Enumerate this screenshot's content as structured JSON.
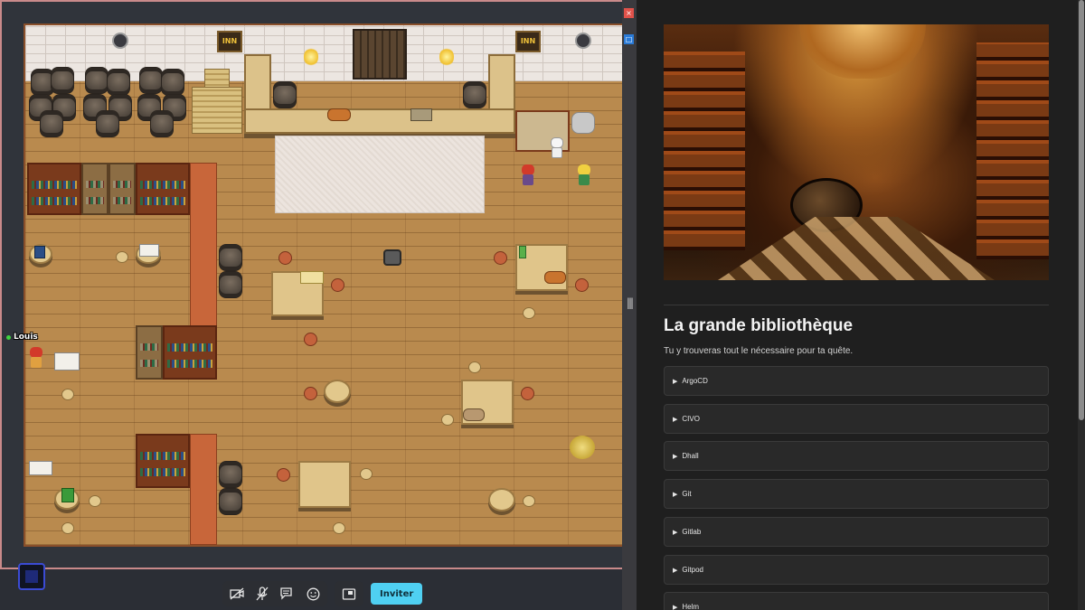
{
  "game": {
    "player_name": "Louis",
    "inn_sign_label": "INN",
    "action_bar": {
      "camera_label": "camera-off",
      "mic_label": "mic-off",
      "chat_label": "chat",
      "emoji_label": "emoji",
      "screen_share_label": "share-screen",
      "invite_label": "Inviter"
    }
  },
  "panel": {
    "close_glyph": "×",
    "minimize_glyph": "□",
    "grip_glyph": "|||",
    "title": "La grande bibliothèque",
    "subtitle": "Tu y trouveras tout le nécessaire pour ta quête.",
    "accordion_marker": "▶",
    "items": [
      {
        "label": "ArgoCD"
      },
      {
        "label": "CIVO"
      },
      {
        "label": "Dhall"
      },
      {
        "label": "Git"
      },
      {
        "label": "Gitlab"
      },
      {
        "label": "Gitpod"
      },
      {
        "label": "Helm"
      }
    ]
  },
  "colors": {
    "invite_button": "#4fd0f2",
    "close_button": "#e0524a",
    "minimize_button": "#2a7bd8",
    "player_status": "#3fd23f"
  }
}
